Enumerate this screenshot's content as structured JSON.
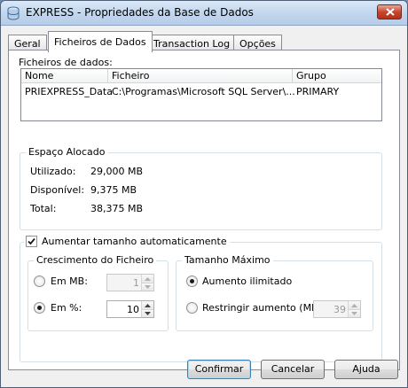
{
  "window": {
    "title": "EXPRESS - Propriedades da Base de Dados"
  },
  "tabs": [
    "Geral",
    "Ficheiros de Dados",
    "Transaction Log",
    "Opções"
  ],
  "active_tab": "Ficheiros de Dados",
  "data_files": {
    "label": "Ficheiros de dados:",
    "columns": [
      "Nome",
      "Ficheiro",
      "Grupo"
    ],
    "rows": [
      {
        "name": "PRIEXPRESS_Data",
        "file": "C:\\Programas\\Microsoft SQL Server\\...",
        "group": "PRIMARY"
      }
    ]
  },
  "allocated": {
    "title": "Espaço Alocado",
    "used_label": "Utilizado:",
    "used_value": "29,000 MB",
    "available_label": "Disponível:",
    "available_value": "9,375 MB",
    "total_label": "Total:",
    "total_value": "38,375 MB"
  },
  "autogrow": {
    "checkbox_label": "Aumentar tamanho automaticamente",
    "checked": true,
    "growth": {
      "title": "Crescimento do Ficheiro",
      "mb_label": "Em MB:",
      "mb_value": "1",
      "pct_label": "Em %:",
      "pct_value": "10",
      "selected": "pct"
    },
    "max_size": {
      "title": "Tamanho Máximo",
      "unlimited_label": "Aumento ilimitado",
      "restrict_label": "Restringir aumento (MB):",
      "restrict_value": "39",
      "selected": "unlimited"
    }
  },
  "buttons": {
    "ok": "Confirmar",
    "cancel": "Cancelar",
    "help": "Ajuda"
  },
  "colors": {
    "title_bar": "#c3d7ee",
    "close_button": "#c8462e",
    "panel": "#ffffff"
  }
}
